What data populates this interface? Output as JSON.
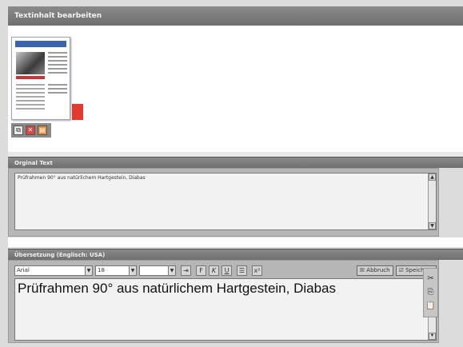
{
  "edit_panel": {
    "title": "Textinhalt bearbeiten"
  },
  "thumbnail_tools": [
    {
      "icon": "copy-icon",
      "glyph": "⧉"
    },
    {
      "icon": "pdf-icon",
      "glyph": "✕"
    },
    {
      "icon": "pdf-document-icon",
      "glyph": "▤"
    }
  ],
  "original": {
    "title": "Orginal Text",
    "text": "Prüfrahmen 90° aus natürlichem Hartgestein, Diabas"
  },
  "translation": {
    "title": "Übersetzung (Englisch: USA)",
    "font_value": "Arial",
    "size_value": "18",
    "third_value": "",
    "bold_label": "F",
    "italic_label": "K",
    "underline_label": "U",
    "list_label": "☰",
    "superscript_label": "x²",
    "indent_label": "⇥",
    "cancel_label": "Abbruch",
    "save_label": "Speichern",
    "text": "Prüfrahmen 90° aus natürlichem Hartgestein, Diabas"
  },
  "side_tools": [
    {
      "icon": "cut-icon",
      "glyph": "✂"
    },
    {
      "icon": "copy-icon",
      "glyph": "⎘"
    },
    {
      "icon": "paste-icon",
      "glyph": "📋"
    }
  ]
}
